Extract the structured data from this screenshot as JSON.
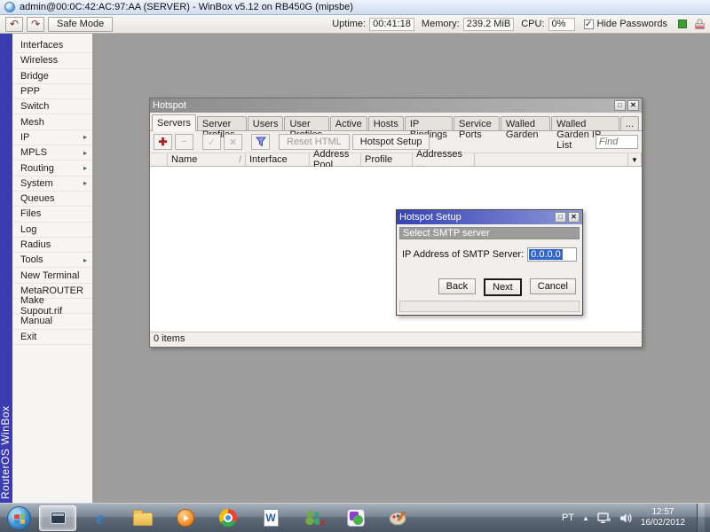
{
  "titlebar": {
    "title": "admin@00:0C:42:AC:97:AA (SERVER) - WinBox v5.12 on RB450G (mipsbe)"
  },
  "topbar": {
    "safe_mode": "Safe Mode",
    "uptime_label": "Uptime:",
    "uptime": "00:41:18",
    "memory_label": "Memory:",
    "memory": "239.2 MiB",
    "cpu_label": "CPU:",
    "cpu": "0%",
    "hide_passwords": "Hide Passwords"
  },
  "brand": {
    "vertical_text": "RouterOS WinBox"
  },
  "sidebar": {
    "items": [
      {
        "label": "Interfaces"
      },
      {
        "label": "Wireless"
      },
      {
        "label": "Bridge"
      },
      {
        "label": "PPP"
      },
      {
        "label": "Switch"
      },
      {
        "label": "Mesh"
      },
      {
        "label": "IP"
      },
      {
        "label": "MPLS"
      },
      {
        "label": "Routing"
      },
      {
        "label": "System"
      },
      {
        "label": "Queues"
      },
      {
        "label": "Files"
      },
      {
        "label": "Log"
      },
      {
        "label": "Radius"
      },
      {
        "label": "Tools"
      },
      {
        "label": "New Terminal"
      },
      {
        "label": "MetaROUTER"
      },
      {
        "label": "Make Supout.rif"
      },
      {
        "label": "Manual"
      },
      {
        "label": "Exit"
      }
    ]
  },
  "hotspot": {
    "title": "Hotspot",
    "tabs": [
      "Servers",
      "Server Profiles",
      "Users",
      "User Profiles",
      "Active",
      "Hosts",
      "IP Bindings",
      "Service Ports",
      "Walled Garden",
      "Walled Garden IP List",
      "..."
    ],
    "toolbar": {
      "reset_html": "Reset HTML",
      "hotspot_setup": "Hotspot Setup",
      "find_placeholder": "Find"
    },
    "columns": {
      "name": "Name",
      "interface": "Interface",
      "address_pool": "Address Pool",
      "profile": "Profile",
      "addresses": "Addresses ..."
    },
    "status": "0 items"
  },
  "dialog": {
    "title": "Hotspot Setup",
    "step": "Select SMTP server",
    "field_label": "IP Address of SMTP Server:",
    "field_value": "0.0.0.0",
    "back": "Back",
    "next": "Next",
    "cancel": "Cancel"
  },
  "taskbar": {
    "lang": "PT",
    "time": "12:57",
    "date": "16/02/2012",
    "ie_letter": "e",
    "word_letter": "W"
  },
  "glyphs": {
    "undo": "↶",
    "redo": "↷",
    "add": "✚",
    "remove": "−",
    "enable": "✓",
    "disable": "✕",
    "maximize": "□",
    "close": "✕",
    "sort": "/",
    "dropdown": "▼",
    "arrow_right": "▸",
    "check": "✓",
    "tray_expand": "▲",
    "msn_x": "✕"
  },
  "colors": {
    "strip_blue": "#3b3bb2",
    "dialog_title_start": "#3542b4",
    "dialog_title_end": "#8d98d8",
    "selection_blue": "#2f66cc",
    "status_green": "#3aa035"
  }
}
